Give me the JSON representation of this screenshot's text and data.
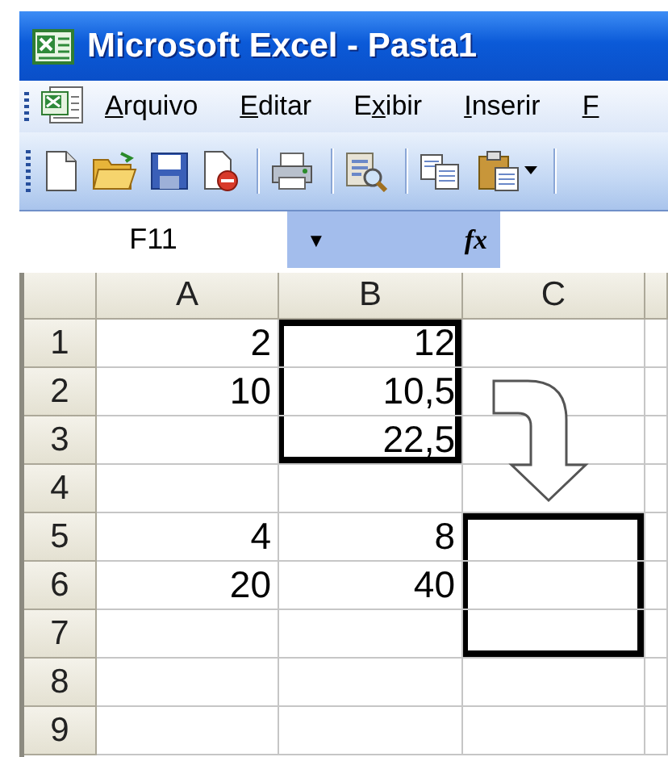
{
  "window": {
    "title": "Microsoft Excel - Pasta1"
  },
  "menu": [
    {
      "key": "A",
      "rest": "rquivo"
    },
    {
      "key": "E",
      "rest": "ditar"
    },
    {
      "lead": "E",
      "key": "x",
      "rest": "ibir"
    },
    {
      "key": "I",
      "rest": "nserir"
    },
    {
      "key": "F"
    }
  ],
  "formula_bar": {
    "name_box": "F11",
    "dropdown": "▼",
    "function_label": "fx"
  },
  "sheet": {
    "columns": [
      "A",
      "B",
      "C"
    ],
    "rows": [
      {
        "number": "1",
        "cells": [
          {
            "value": "2"
          },
          {
            "value": "12",
            "framed": true
          },
          {}
        ]
      },
      {
        "number": "2",
        "cells": [
          {
            "value": "10"
          },
          {
            "value": "10,5",
            "framed": true
          },
          {}
        ]
      },
      {
        "number": "3",
        "cells": [
          {},
          {
            "value": "22,5",
            "framed": true
          },
          {}
        ]
      },
      {
        "number": "4",
        "cells": [
          {},
          {},
          {}
        ]
      },
      {
        "number": "5",
        "cells": [
          {
            "value": "4"
          },
          {
            "value": "8"
          },
          {
            "framed": true
          }
        ]
      },
      {
        "number": "6",
        "cells": [
          {
            "value": "20"
          },
          {
            "value": "40"
          },
          {
            "framed": true
          }
        ]
      },
      {
        "number": "7",
        "cells": [
          {},
          {},
          {
            "framed": true
          }
        ]
      },
      {
        "number": "8",
        "cells": [
          {},
          {},
          {}
        ]
      },
      {
        "number": "9",
        "cells": [
          {},
          {},
          {}
        ]
      }
    ]
  }
}
